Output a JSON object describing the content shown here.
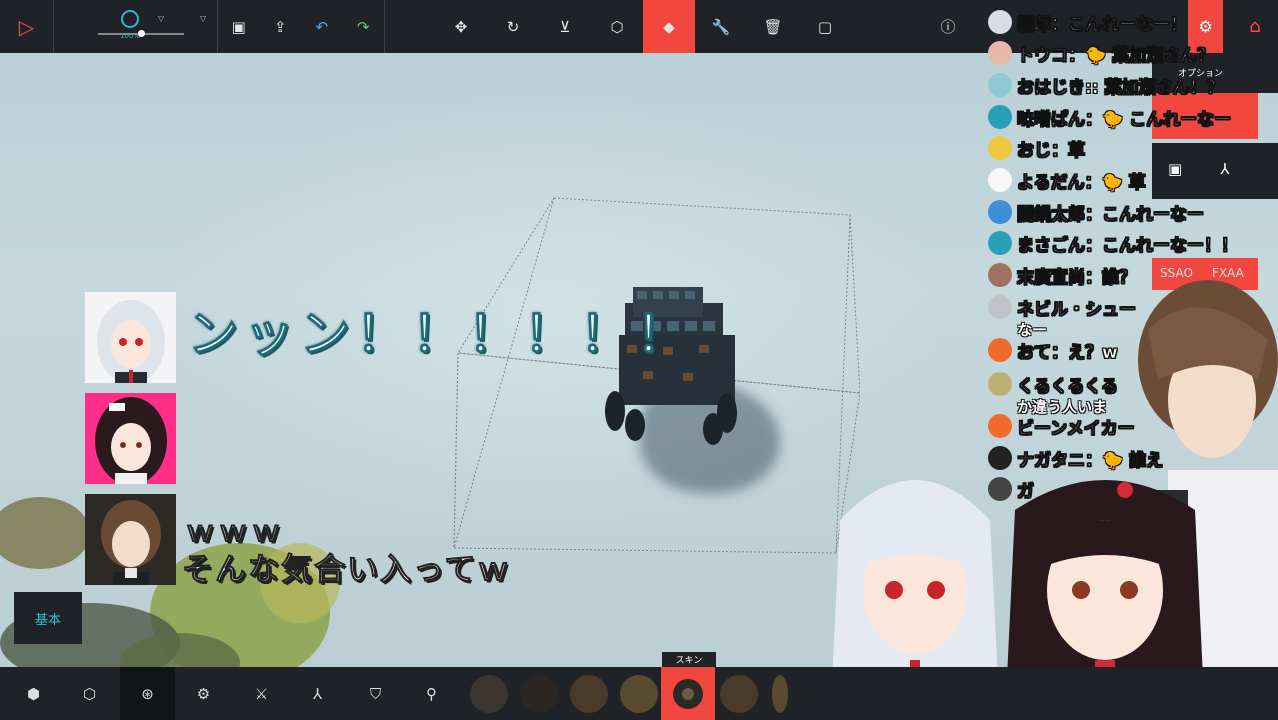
{
  "toolbar": {
    "speed_value": "100%",
    "settings_icon": "gear-icon",
    "home_icon": "home-icon"
  },
  "scene": {
    "shout_text": "ンッン！！！！！！",
    "www_text": "ｗｗｗ",
    "reply_text": "そんな気合い入ってｗ"
  },
  "panel": {
    "option_label": "オプション",
    "ssao_label": "SSAO",
    "fxaa_label": "FXAA"
  },
  "chat": [
    {
      "text": "霜印：こんれーなー！",
      "avatar_color": "#d9dde3"
    },
    {
      "text": "トウコ：🐤 葉加瀬さん？",
      "avatar_color": "#e8b8a8"
    },
    {
      "text": "おはじき:: 葉加瀬さん！？",
      "avatar_color": "#8ec9d8"
    },
    {
      "text": "味噌ぱん：🐤 こんれーなー",
      "avatar_color": "#2aa0b8"
    },
    {
      "text": "おじ：草",
      "avatar_color": "#f0c840"
    },
    {
      "text": "よるだん：🐤 草",
      "avatar_color": "#f7f7f7"
    },
    {
      "text": "闇鍋太郎：こんれーなー",
      "avatar_color": "#3d8fd8"
    },
    {
      "text": "まさごん：こんれーなー！！",
      "avatar_color": "#2aa0b8"
    },
    {
      "text": "末廣宣尚：誰？",
      "avatar_color": "#a07060"
    },
    {
      "text": "ネビル・シュー",
      "sub": "なー",
      "avatar_color": "#c0c4c8"
    },
    {
      "text": "おて：え？w",
      "avatar_color": "#f06a2a"
    },
    {
      "text": "くるくるくる",
      "sub": "か違う人いま",
      "avatar_color": "#b8b070"
    },
    {
      "text": "ビーンメイカー",
      "avatar_color": "#f06a2a"
    },
    {
      "text": "ナガタニ：🐤 誰え",
      "avatar_color": "#222222"
    },
    {
      "text": "ガ",
      "avatar_color": "#444444"
    }
  ],
  "bottom": {
    "basic_tab_label": "基本",
    "skin_label": "スキン"
  }
}
